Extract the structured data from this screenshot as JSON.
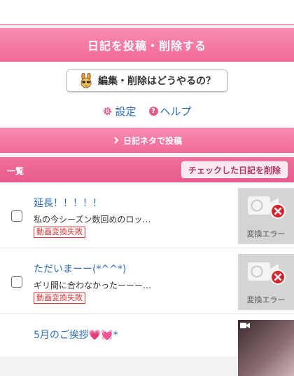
{
  "post_banner": {
    "label": "日記を投稿・削除する"
  },
  "howto_button": {
    "label": "編集・削除はどうやるの？"
  },
  "links": {
    "settings": "設定",
    "help": "ヘルプ"
  },
  "neta_banner": {
    "label": "日記ネタで投稿"
  },
  "list_header": {
    "title": "一覧",
    "delete_checked": "チェックした日記を削除"
  },
  "entries": [
    {
      "title": "延長！！！！！",
      "excerpt": "私の今シーズン数回めのロッ…",
      "error": "動画変換失敗",
      "thumb_caption": "変換エラー"
    },
    {
      "title": "ただいまーー(*^^*)",
      "excerpt": "ギリ間に合わなかったーーー…",
      "error": "動画変換失敗",
      "thumb_caption": "変換エラー"
    },
    {
      "title": "5月のご挨拶💗💓*"
    }
  ],
  "colors": {
    "pink_banner": "#f06a96",
    "link_blue": "#2b6fc2",
    "error_red": "#e23636"
  },
  "icons": {
    "howto": "rabbit-mascot-icon",
    "settings": "gear-icon",
    "help": "question-circle-icon",
    "neta": "chevron-right-icon",
    "thumb": "video-camera-error-icon"
  }
}
